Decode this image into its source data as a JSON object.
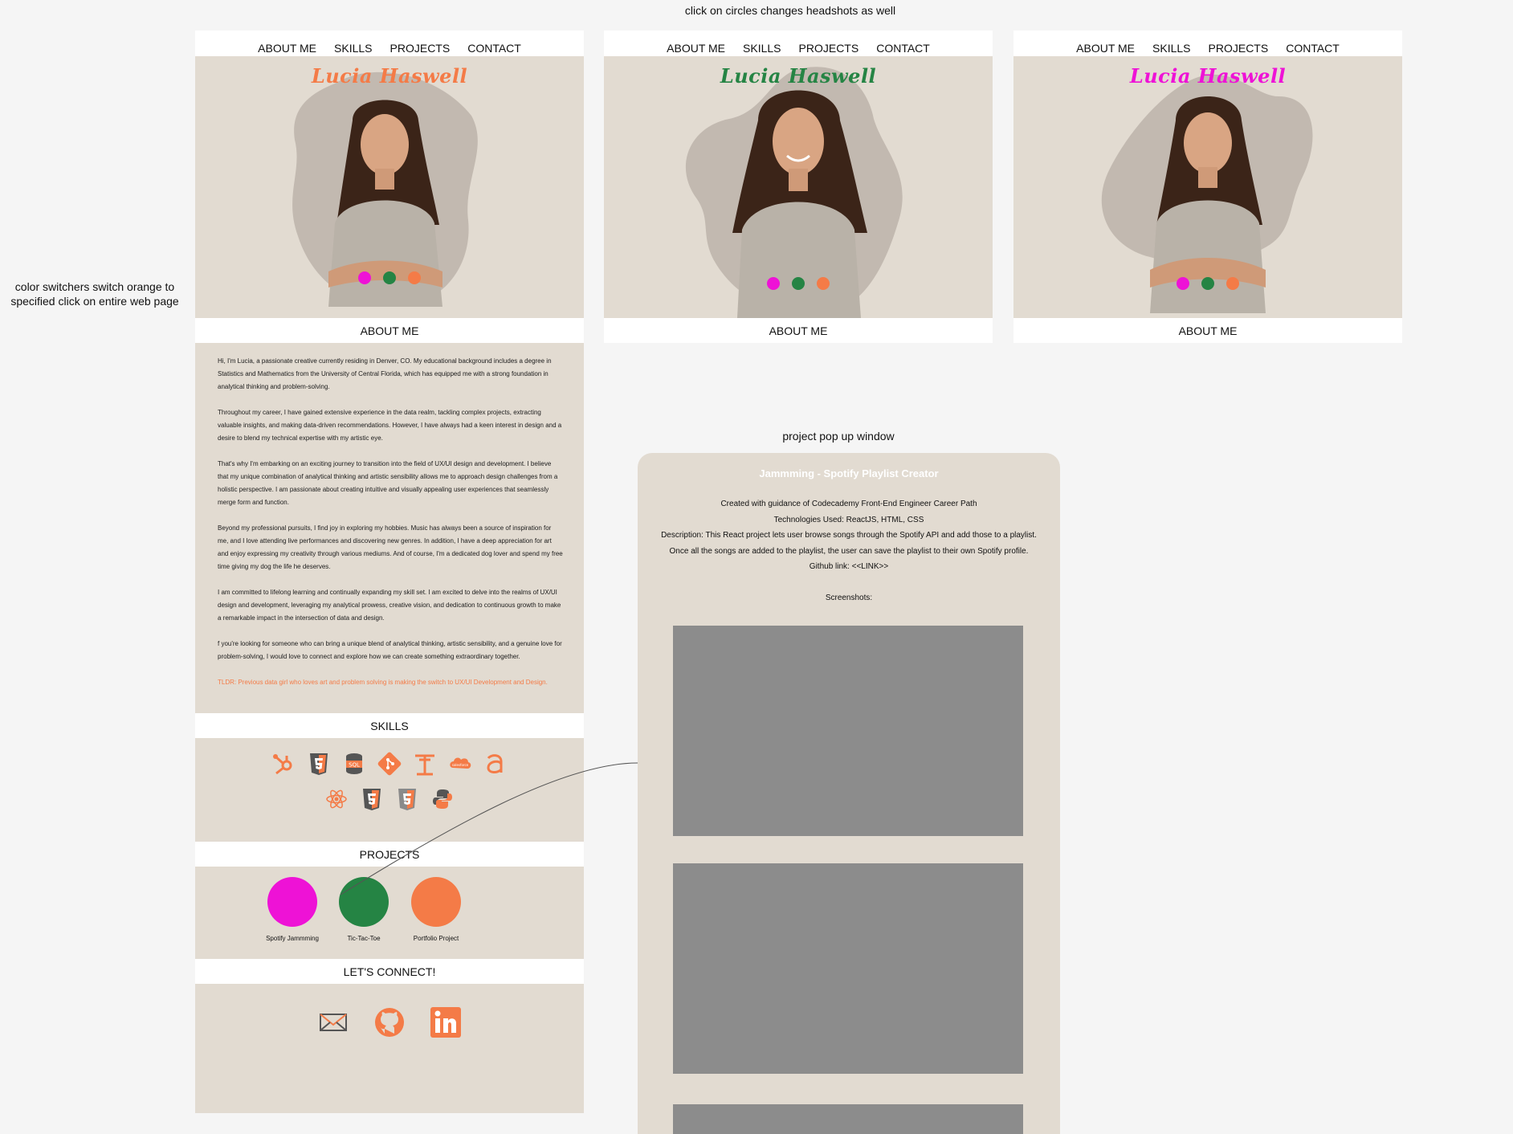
{
  "annotations": {
    "top": "click on circles changes headshots as well",
    "left": "color switchers switch orange to specified click on entire web page",
    "popup": "project pop up window"
  },
  "colors": {
    "beige": "#e2dbd1",
    "orange": "#f47b47",
    "magenta": "#ee12d6",
    "green": "#258444",
    "white": "#ffffff",
    "placeholder_gray": "#8c8c8c"
  },
  "nav": {
    "about": "ABOUT ME",
    "skills": "SKILLS",
    "projects": "PROJECTS",
    "contact": "CONTACT"
  },
  "hero": {
    "name": "Lucia Haswell"
  },
  "sections": {
    "about": "ABOUT ME",
    "skills": "SKILLS",
    "projects": "PROJECTS",
    "connect": "LET'S CONNECT!"
  },
  "about_paragraphs": [
    "Hi, I'm Lucia, a passionate creative  currently residing in Denver, CO. My educational background includes a degree in Statistics and Mathematics from the University of Central Florida, which has equipped me with a strong foundation in analytical thinking and problem-solving.",
    "Throughout my career, I have gained extensive experience in the data realm, tackling complex projects, extracting valuable insights, and making data-driven recommendations. However, I have always had a keen interest in design and a desire to blend my technical expertise with my artistic eye.",
    "That's why I'm embarking on an exciting journey to transition into the field of UX/UI design and development. I believe that my unique combination of analytical thinking and artistic sensibility allows me to approach design challenges from a holistic perspective. I am passionate about creating intuitive and visually appealing user experiences that seamlessly merge form and function.",
    "Beyond my professional pursuits, I find joy in exploring my hobbies. Music has always been a source of inspiration for me, and I love attending live performances and discovering new genres. In addition, I have a deep appreciation for art and enjoy expressing my creativity through various mediums. And of course, I'm a dedicated dog lover and spend my free time giving my dog the life he deserves.",
    "I am committed to lifelong learning and continually expanding my skill set. I am excited to delve into the realms of UX/UI design and development, leveraging my analytical prowess, creative vision, and dedication to continuous growth to make a remarkable impact in the intersection of data and design.",
    "f you're looking for someone who can bring a unique blend of analytical thinking, artistic sensibility, and a genuine love for problem-solving, I would love to connect and explore how we can create something extraordinary together."
  ],
  "about_tldr": "TLDR: Previous data girl who loves art and problem solving is making the switch to UX/UI Development and Design.",
  "skills_icons": {
    "row1": [
      "hubspot-icon",
      "html5-icon",
      "sql-icon",
      "git-icon",
      "tableau-icon",
      "salesforce-icon",
      "alteryx-icon"
    ],
    "row2": [
      "react-icon",
      "css3-icon",
      "html5-icon",
      "python-icon"
    ]
  },
  "salesforce_text": "salesforce",
  "sql_text": "SQL",
  "projects": [
    {
      "label": "Spotify Jammming",
      "color": "#ee12d6"
    },
    {
      "label": "Tic-Tac-Toe",
      "color": "#258444"
    },
    {
      "label": "Portfolio Project",
      "color": "#f47b47"
    }
  ],
  "social_icons": [
    "mail-icon",
    "github-icon",
    "linkedin-icon"
  ],
  "popup": {
    "title": "Jammming - Spotify Playlist Creator",
    "line1": "Created with guidance of Codecademy Front-End Engineer Career Path",
    "line2": "Technologies Used: ReactJS, HTML, CSS",
    "line3": "Description: This React project lets user browse songs through the Spotify API and add those to a playlist.",
    "line4": "Once all the songs are added to the playlist, the user can save the playlist to their own Spotify profile.",
    "line5": "Github link: <<LINK>>",
    "screenshots_label": "Screenshots:"
  }
}
